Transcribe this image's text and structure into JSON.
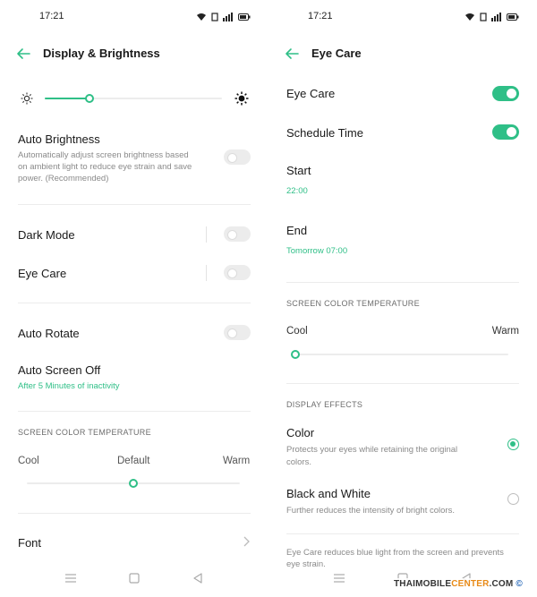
{
  "colors": {
    "accent": "#2fbf87",
    "text": "#1a1a1a",
    "muted": "#8a8a8a"
  },
  "left": {
    "status_time": "17:21",
    "title": "Display & Brightness",
    "brightness": {
      "level": 0.25,
      "low_icon": "sun-small-icon",
      "high_icon": "sun-large-icon"
    },
    "auto_brightness": {
      "label": "Auto Brightness",
      "desc1": "Automatically adjust screen brightness based",
      "desc2": "on ambient light to reduce eye strain and save",
      "desc3": "power. (Recommended)",
      "on": false
    },
    "dark_mode": {
      "label": "Dark Mode",
      "on": false
    },
    "eye_care": {
      "label": "Eye Care",
      "on": false
    },
    "auto_rotate": {
      "label": "Auto Rotate",
      "on": false
    },
    "auto_screen_off": {
      "label": "Auto Screen Off",
      "value": "After 5 Minutes of inactivity"
    },
    "color_temp": {
      "section": "SCREEN COLOR TEMPERATURE",
      "cool": "Cool",
      "default": "Default",
      "warm": "Warm",
      "level": 0.5
    },
    "font": {
      "label": "Font"
    }
  },
  "right": {
    "status_time": "17:21",
    "title": "Eye Care",
    "eye_care": {
      "label": "Eye Care",
      "on": true
    },
    "schedule_time": {
      "label": "Schedule Time",
      "on": true
    },
    "start": {
      "label": "Start",
      "value": "22:00"
    },
    "end": {
      "label": "End",
      "value": "Tomorrow 07:00"
    },
    "color_temp": {
      "section": "SCREEN COLOR TEMPERATURE",
      "cool": "Cool",
      "warm": "Warm",
      "level": 0.0
    },
    "display_effects": {
      "section": "DISPLAY EFFECTS",
      "color": {
        "label": "Color",
        "desc1": "Protects your eyes while retaining the original",
        "desc2": "colors.",
        "selected": true
      },
      "bw": {
        "label": "Black and White",
        "desc": "Further reduces the intensity of bright colors.",
        "selected": false
      }
    },
    "footer_note1": "Eye Care reduces blue light from the screen and prevents",
    "footer_note2": "eye strain."
  },
  "watermark": {
    "pre": "THAIMOBILE",
    "accent": "CENTER",
    "post": ".COM"
  }
}
